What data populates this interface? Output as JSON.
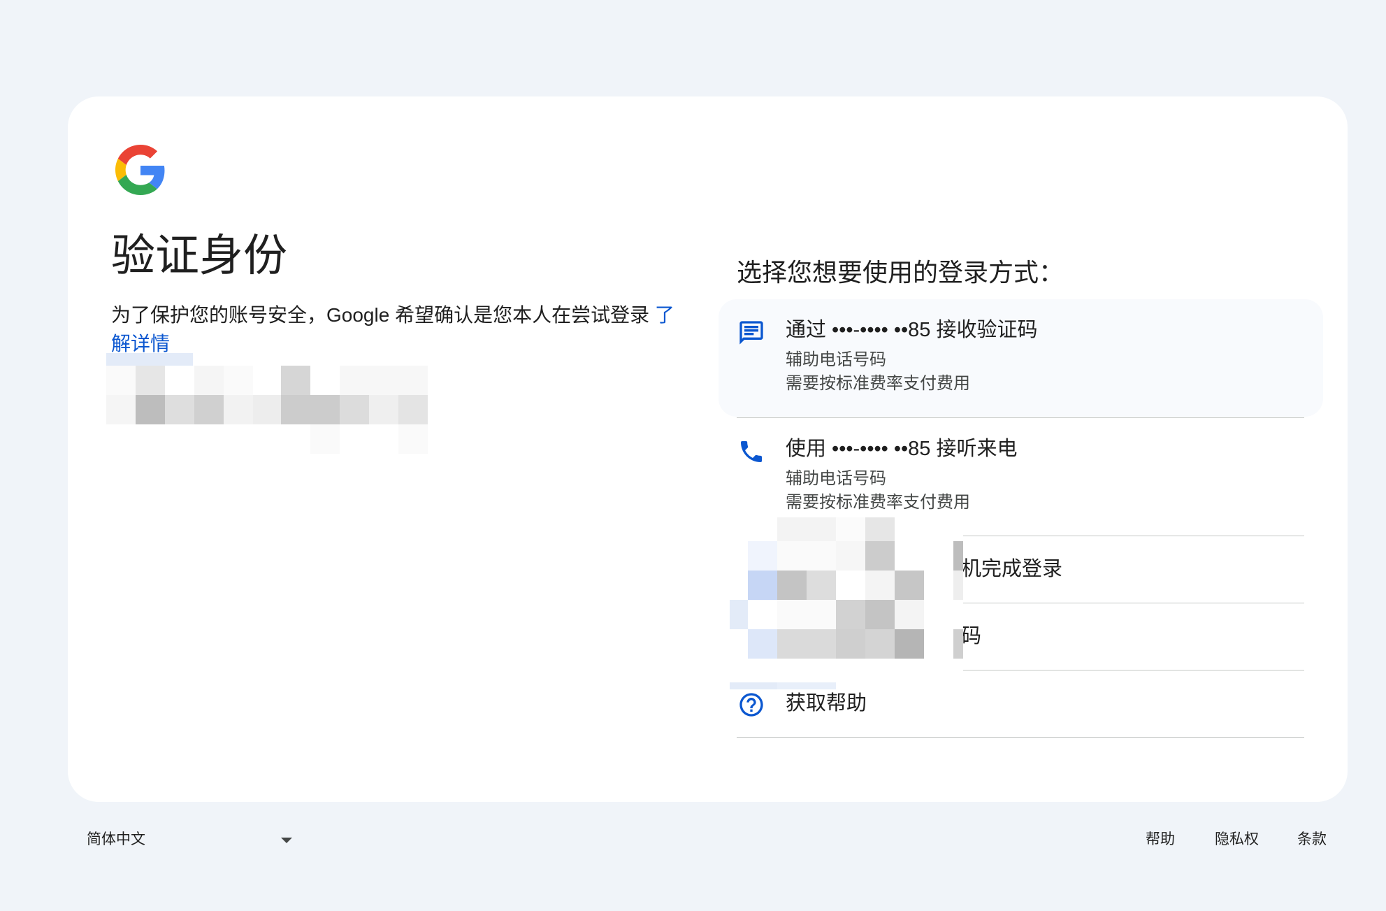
{
  "brand": {
    "logo_icon": "google-g-logo"
  },
  "page": {
    "title": "验证身份",
    "description": "为了保护您的账号安全，Google 希望确认是您本人在尝试登录 ",
    "learn_more": "了解详情"
  },
  "choices": {
    "heading": "选择您想要使用的登录方式：",
    "options": [
      {
        "icon": "sms-icon",
        "title": "通过 •••-•••• ••85 接收验证码",
        "sub1": "辅助电话号码",
        "sub2": "需要按标准费率支付费用"
      },
      {
        "icon": "phone-icon",
        "title": "使用 •••-•••• ••85 接听来电",
        "sub1": "辅助电话号码",
        "sub2": "需要按标准费率支付费用"
      },
      {
        "icon": "device-icon",
        "title": "机完成登录"
      },
      {
        "icon": "key-icon",
        "title": "码"
      },
      {
        "icon": "help-icon",
        "title": "获取帮助"
      }
    ]
  },
  "footer": {
    "language": "简体中文",
    "help": "帮助",
    "privacy": "隐私权",
    "terms": "条款"
  },
  "colors": {
    "background": "#f0f4f9",
    "card": "#ffffff",
    "accent": "#0b57d0",
    "text": "#1f1f1f",
    "subtext": "#444746"
  }
}
